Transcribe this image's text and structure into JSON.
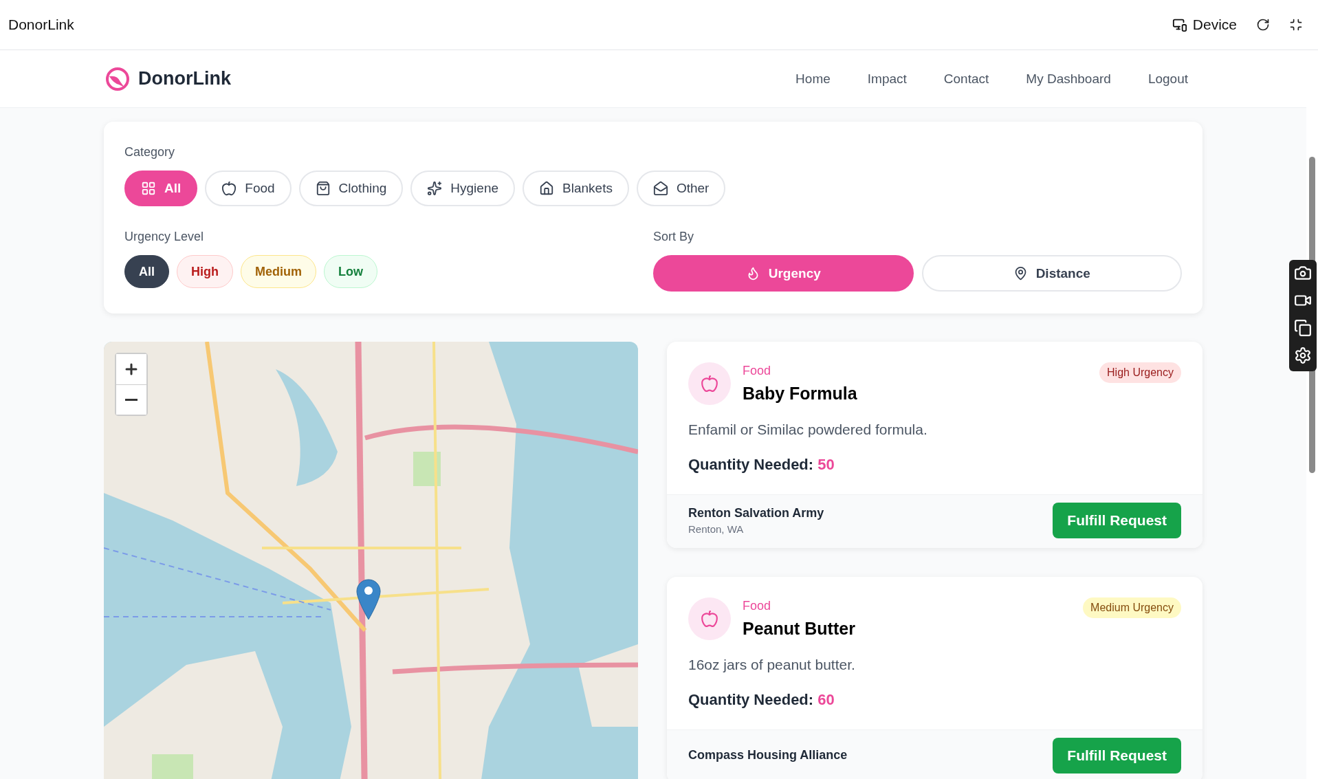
{
  "topbar": {
    "title": "DonorLink",
    "device_label": "Device"
  },
  "navbar": {
    "brand": "DonorLink",
    "links": [
      {
        "label": "Home"
      },
      {
        "label": "Impact"
      },
      {
        "label": "Contact"
      },
      {
        "label": "My Dashboard"
      },
      {
        "label": "Logout"
      }
    ]
  },
  "filters": {
    "category": {
      "label": "Category",
      "options": [
        {
          "label": "All",
          "selected": true
        },
        {
          "label": "Food",
          "selected": false
        },
        {
          "label": "Clothing",
          "selected": false
        },
        {
          "label": "Hygiene",
          "selected": false
        },
        {
          "label": "Blankets",
          "selected": false
        },
        {
          "label": "Other",
          "selected": false
        }
      ]
    },
    "urgency": {
      "label": "Urgency Level",
      "options": [
        {
          "label": "All",
          "kind": "all",
          "selected": true
        },
        {
          "label": "High",
          "kind": "high",
          "selected": false
        },
        {
          "label": "Medium",
          "kind": "medium",
          "selected": false
        },
        {
          "label": "Low",
          "kind": "low",
          "selected": false
        }
      ]
    },
    "sort": {
      "label": "Sort By",
      "options": [
        {
          "label": "Urgency",
          "selected": true
        },
        {
          "label": "Distance",
          "selected": false
        }
      ]
    }
  },
  "requests": [
    {
      "category": "Food",
      "title": "Baby Formula",
      "description": "Enfamil or Similac powdered formula.",
      "quantity_label": "Quantity Needed:",
      "quantity": "50",
      "kind": "high",
      "badge": "High Urgency",
      "organization": "Renton Salvation Army",
      "location": "Renton, WA",
      "action": "Fulfill Request"
    },
    {
      "category": "Food",
      "title": "Peanut Butter",
      "description": "16oz jars of peanut butter.",
      "quantity_label": "Quantity Needed:",
      "quantity": "60",
      "kind": "medium",
      "badge": "Medium Urgency",
      "organization": "Compass Housing Alliance",
      "action": "Fulfill Request"
    }
  ]
}
